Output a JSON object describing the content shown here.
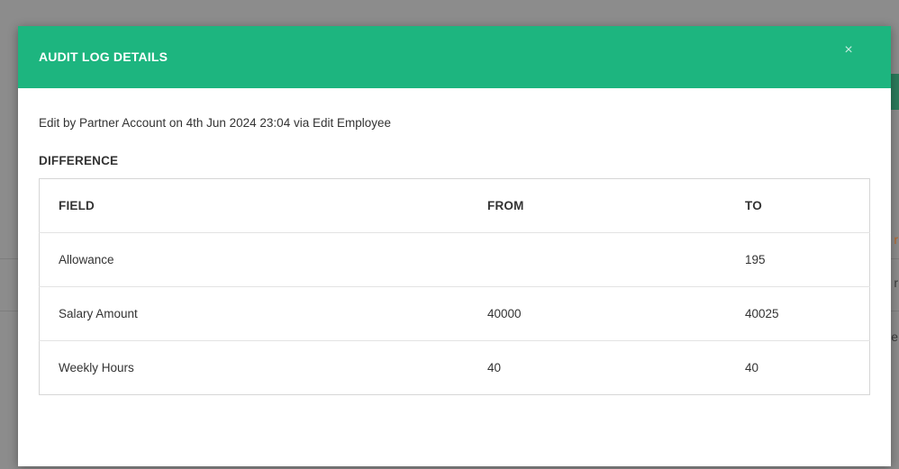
{
  "modal": {
    "title": "AUDIT LOG DETAILS",
    "close_icon": "close-icon",
    "close_glyph": "×",
    "edit_summary": "Edit by Partner Account on 4th Jun 2024 23:04 via Edit Employee",
    "section_title": "DIFFERENCE"
  },
  "table": {
    "headers": {
      "field": "FIELD",
      "from": "FROM",
      "to": "TO"
    },
    "rows": [
      {
        "field": "Allowance",
        "from": "",
        "to": "195"
      },
      {
        "field": "Salary Amount",
        "from": "40000",
        "to": "40025"
      },
      {
        "field": "Weekly Hours",
        "from": "40",
        "to": "40"
      }
    ]
  },
  "background": {
    "partial_letters": [
      "r",
      "r",
      "e"
    ]
  },
  "colors": {
    "header_green": "#1db57f",
    "overlay_gray": "#8f8f8f"
  }
}
